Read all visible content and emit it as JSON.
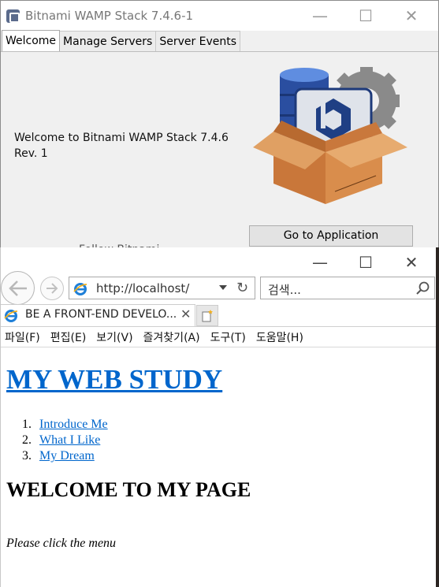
{
  "bitnami": {
    "title": "Bitnami WAMP Stack 7.4.6-1",
    "tabs": [
      {
        "label": "Welcome",
        "active": true
      },
      {
        "label": "Manage Servers",
        "active": false
      },
      {
        "label": "Server Events",
        "active": false
      }
    ],
    "welcome_text": "Welcome to Bitnami WAMP Stack 7.4.6 Rev. 1",
    "go_button": "Go to Application",
    "follow_text": "Follow Bitnami",
    "window_controls": {
      "minimize": "—",
      "maximize": "☐",
      "close": "✕"
    }
  },
  "ie": {
    "window_controls": {
      "minimize": "—",
      "maximize": "☐",
      "close": "✕"
    },
    "address": "http://localhost/",
    "search_placeholder": "검색...",
    "tab_title": "BE A FRONT-END DEVELO...",
    "tab_close": "✕",
    "menus": [
      "파일(F)",
      "편집(E)",
      "보기(V)",
      "즐겨찾기(A)",
      "도구(T)",
      "도움말(H)"
    ]
  },
  "page": {
    "heading": "MY WEB STUDY",
    "links": [
      {
        "num": "1.",
        "text": "Introduce Me"
      },
      {
        "num": "2.",
        "text": "What I Like"
      },
      {
        "num": "3.",
        "text": "My Dream"
      }
    ],
    "subheading": "WELCOME TO MY PAGE",
    "note": "Please click the menu"
  },
  "colors": {
    "link": "#0066cc",
    "bitnami_bg": "#f0f0f0",
    "ie_icon": "#1e7fd8"
  }
}
